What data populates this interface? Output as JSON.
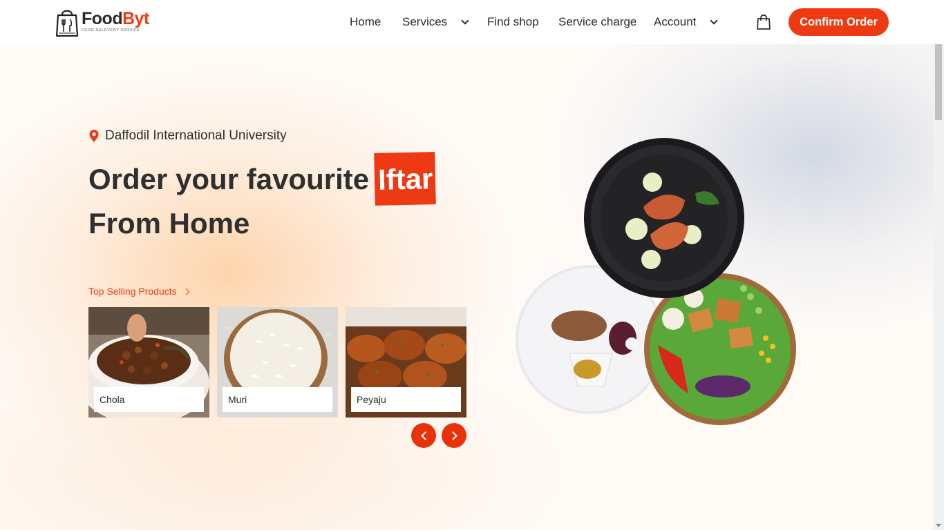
{
  "header": {
    "logo": {
      "brand_first": "Food",
      "brand_second": "Byt",
      "tagline": "FOOD DELEVERY SERVICE"
    },
    "nav": [
      {
        "label": "Home",
        "has_dropdown": false
      },
      {
        "label": "Services",
        "has_dropdown": true
      },
      {
        "label": "Find shop",
        "has_dropdown": false
      },
      {
        "label": "Service charge",
        "has_dropdown": false
      },
      {
        "label": "Account",
        "has_dropdown": true
      }
    ],
    "cart_icon": "shopping-bag-icon",
    "confirm_label": "Confirm Order"
  },
  "hero": {
    "location": "Daffodil International University",
    "location_icon": "map-pin-icon",
    "headline_part1": "Order your favourite",
    "headline_highlight": "Iftar",
    "headline_line2": "From Home",
    "top_selling_label": "Top Selling Products",
    "products": [
      {
        "name": "Chola"
      },
      {
        "name": "Muri"
      },
      {
        "name": "Peyaju"
      }
    ],
    "prev_icon": "chevron-left-icon",
    "next_icon": "chevron-right-icon"
  },
  "colors": {
    "accent": "#ee3a12",
    "text": "#2b2b2b",
    "white": "#ffffff"
  }
}
